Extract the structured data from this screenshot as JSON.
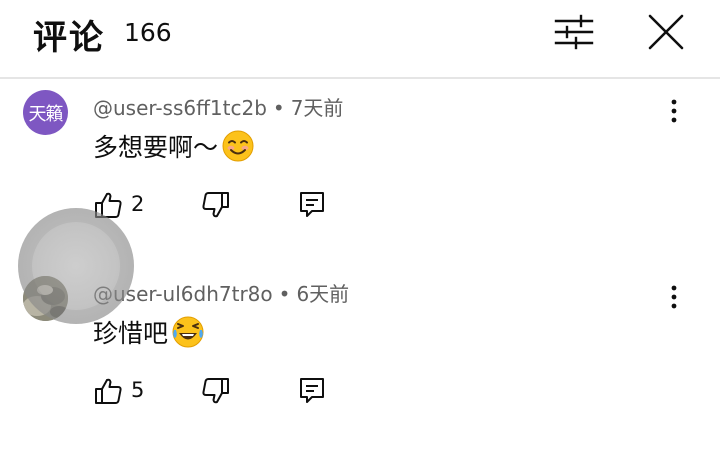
{
  "header": {
    "title": "评论",
    "count": "166"
  },
  "comments": [
    {
      "avatar_text": "天籟",
      "avatar_color": "#7e57c2",
      "author": "@user-ss6ff1tc2b",
      "time": "7天前",
      "text": "多想要啊～",
      "emoji": "smiling-face",
      "likes": "2"
    },
    {
      "avatar_text": "",
      "avatar_color": "#9a9a8a",
      "author": "@user-ul6dh7tr8o",
      "time": "6天前",
      "text": "珍惜吧",
      "emoji": "tears-of-joy-face",
      "likes": "5"
    }
  ],
  "colors": {
    "text_primary": "#0f0f0f",
    "text_secondary": "#606060",
    "divider": "#e5e5e5"
  }
}
